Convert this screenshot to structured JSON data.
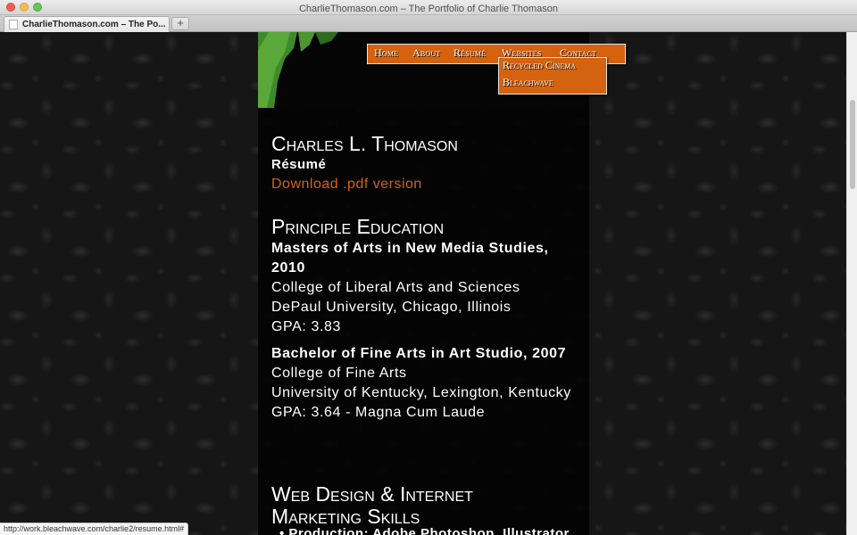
{
  "window": {
    "title": "CharlieThomason.com – The Portfolio of Charlie Thomason",
    "tab_label": "CharlieThomason.com – The Po...",
    "new_tab_label": "+"
  },
  "nav": {
    "items": [
      "Home",
      "About",
      "Résumé",
      "Websites",
      "Contact"
    ],
    "submenu": [
      "Recycled Cinema",
      "Bleachwave"
    ]
  },
  "page": {
    "name_heading": "Charles L. Thomason",
    "subheading": "Résumé",
    "download_link": "Download .pdf version",
    "education_heading": "Principle Education",
    "education": [
      {
        "degree": "Masters of Arts in New Media Studies, 2010",
        "lines": [
          "College of Liberal Arts and Sciences",
          "DePaul University, Chicago, Illinois",
          "GPA: 3.83"
        ]
      },
      {
        "degree": "Bachelor of Fine Arts in Art Studio, 2007",
        "lines": [
          "College of Fine Arts",
          "University of Kentucky, Lexington, Kentucky",
          "GPA: 3.64 - Magna Cum Laude"
        ]
      }
    ],
    "skills_heading_line1": "Web Design & Internet",
    "skills_heading_line2": "Marketing Skills",
    "skills_peek": "• Production: Adobe Photoshop, Illustrator,"
  },
  "status_bar": {
    "url": "http://work.bleachwave.com/charlie2/resume.html#"
  },
  "colors": {
    "accent": "#d4620f",
    "text": "#ffffff",
    "column_bg": "#000000"
  }
}
